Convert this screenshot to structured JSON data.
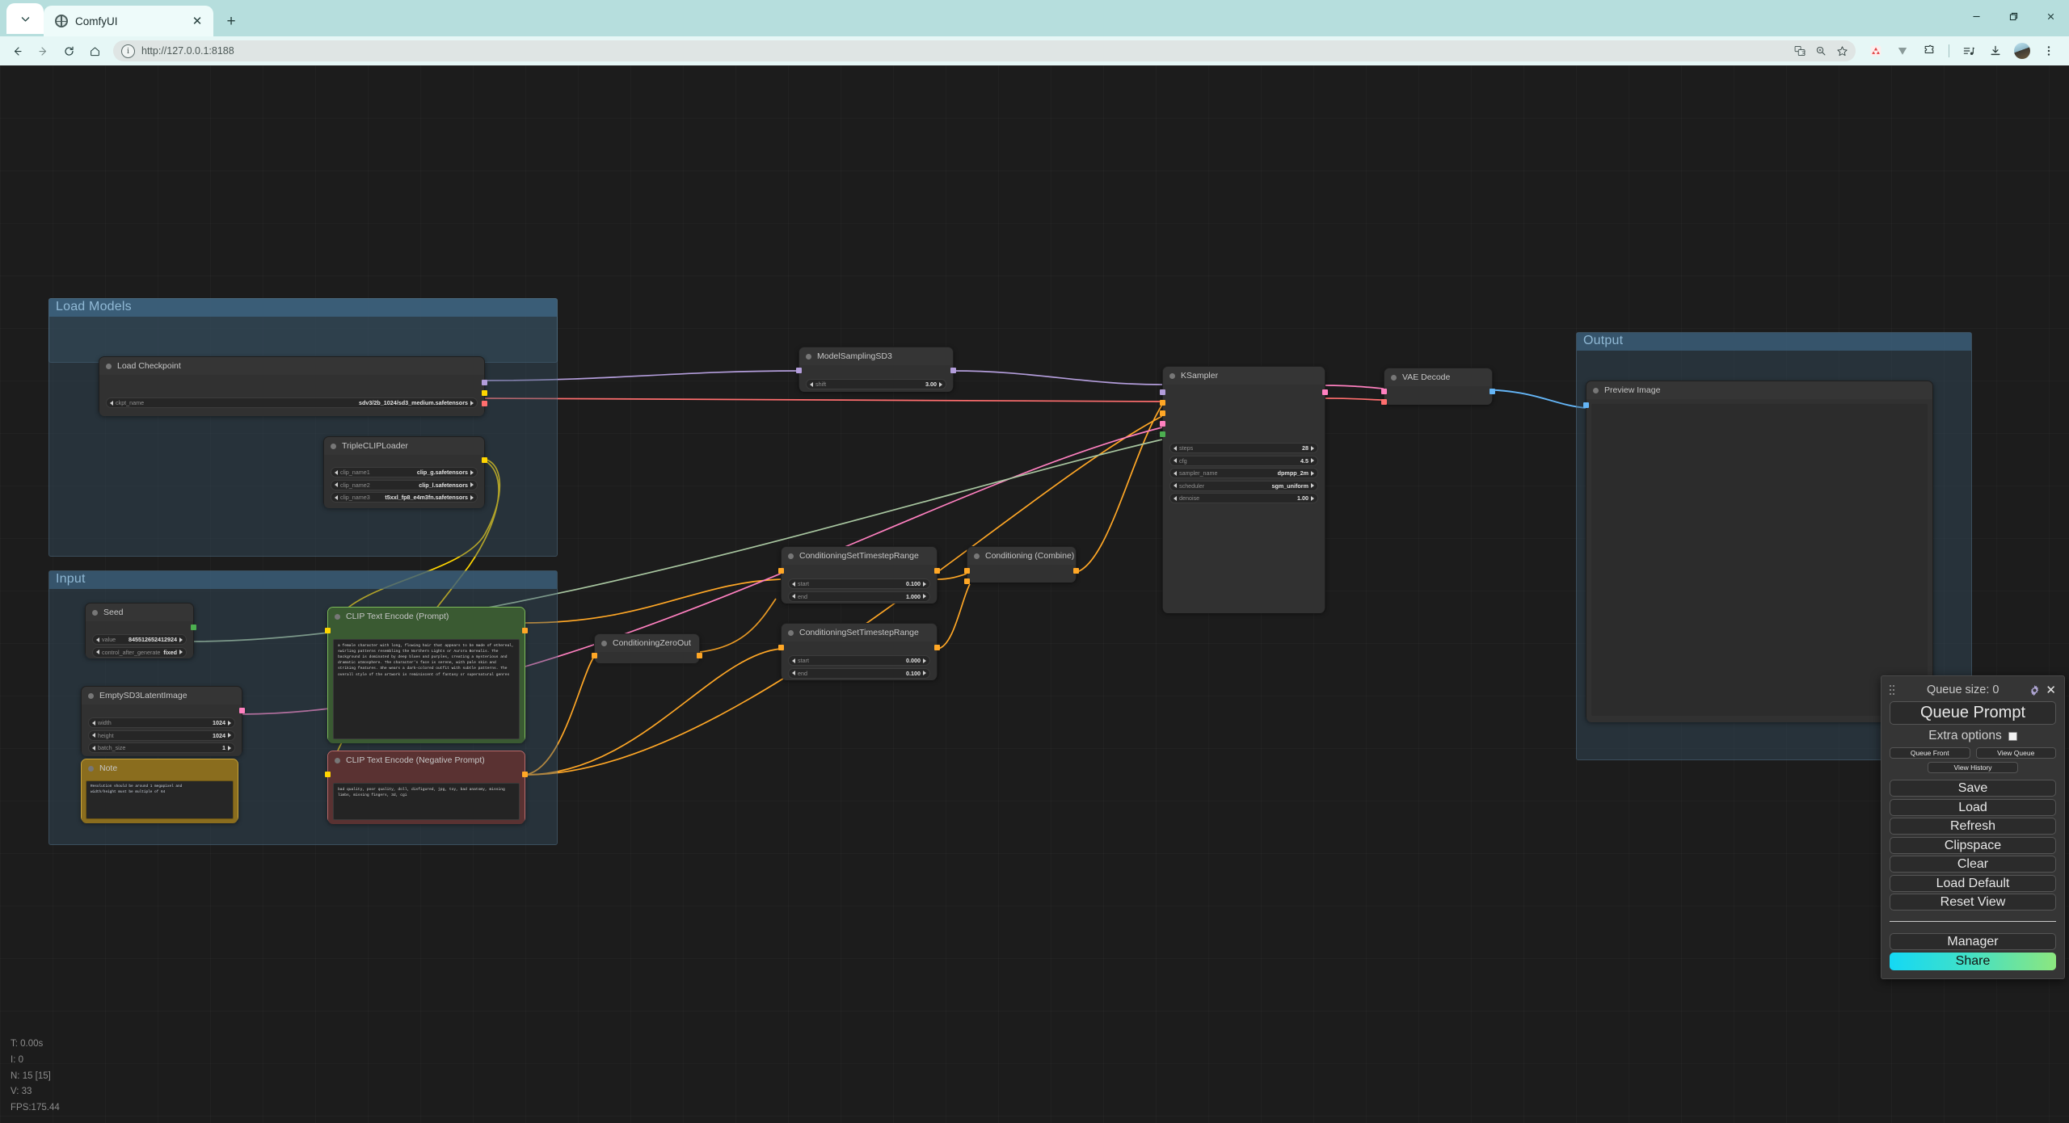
{
  "browser": {
    "tab": {
      "title": "ComfyUI",
      "favicon_icon": "globe-icon",
      "close_icon": "close-icon"
    },
    "new_tab_label": "+",
    "tab_list_icon": "chevron-down-icon",
    "nav": {
      "back_icon": "back-arrow-icon",
      "forward_icon": "forward-arrow-icon",
      "reload_icon": "reload-icon",
      "home_icon": "home-icon"
    },
    "omnibox": {
      "url": "http://127.0.0.1:8188",
      "info_icon": "page-info-icon",
      "translate_icon": "translate-icon",
      "zoom_icon": "zoom-icon",
      "bookmark_icon": "star-icon"
    },
    "extensions": [
      {
        "name": "extension-red-icon"
      },
      {
        "name": "extension-v-icon"
      },
      {
        "name": "extensions-puzzle-icon"
      },
      {
        "name": "media-list-icon"
      },
      {
        "name": "downloads-icon"
      },
      {
        "name": "profile-avatar-icon"
      },
      {
        "name": "chrome-menu-icon"
      }
    ],
    "window_controls": {
      "minimize": "minimize-icon",
      "maximize": "maximize-icon",
      "close": "window-close-icon"
    }
  },
  "groups": [
    {
      "title": "Load Models"
    },
    {
      "title": "Input"
    },
    {
      "title": "Output"
    }
  ],
  "nodes": {
    "load_checkpoint": {
      "title": "Load Checkpoint",
      "widgets": [
        {
          "name": "ckpt_name",
          "value": "sdv3/2b_1024/sd3_medium.safetensors"
        }
      ]
    },
    "triple_clip_loader": {
      "title": "TripleCLIPLoader",
      "widgets": [
        {
          "name": "clip_name1",
          "value": "clip_g.safetensors"
        },
        {
          "name": "clip_name2",
          "value": "clip_l.safetensors"
        },
        {
          "name": "clip_name3",
          "value": "t5xxl_fp8_e4m3fn.safetensors"
        }
      ]
    },
    "seed": {
      "title": "Seed",
      "widgets": [
        {
          "name": "value",
          "value": "845512652412924"
        },
        {
          "name": "control_after_generate",
          "value": "fixed"
        }
      ]
    },
    "empty_sd3_latent": {
      "title": "EmptySD3LatentImage",
      "widgets": [
        {
          "name": "width",
          "value": "1024"
        },
        {
          "name": "height",
          "value": "1024"
        },
        {
          "name": "batch_size",
          "value": "1"
        }
      ]
    },
    "note": {
      "title": "Note",
      "text": "Resolution should be around 1 megapixel and\nwidth/height must be multiple of 64"
    },
    "clip_text_encode_positive": {
      "title": "CLIP Text Encode (Prompt)",
      "text": "a female character with long, flowing hair that appears to be made of ethereal, swirling patterns resembling the Northern Lights or Aurora Borealis. The background is dominated by deep blues and purples, creating a mysterious and dramatic atmosphere. The character's face is serene, with pale skin and striking features. She wears a dark-colored outfit with subtle patterns. The overall style of the artwork is reminiscent of fantasy or supernatural genres"
    },
    "clip_text_encode_negative": {
      "title": "CLIP Text Encode (Negative Prompt)",
      "text": "bad quality, poor quality, doll, disfigured, jpg, toy, bad anatomy, missing limbs, missing fingers, 3d, cgi"
    },
    "model_sampling_sd3": {
      "title": "ModelSamplingSD3",
      "widgets": [
        {
          "name": "shift",
          "value": "3.00"
        }
      ]
    },
    "cond_set_range_1": {
      "title": "ConditioningSetTimestepRange",
      "widgets": [
        {
          "name": "start",
          "value": "0.100"
        },
        {
          "name": "end",
          "value": "1.000"
        }
      ]
    },
    "cond_set_range_2": {
      "title": "ConditioningSetTimestepRange",
      "widgets": [
        {
          "name": "start",
          "value": "0.000"
        },
        {
          "name": "end",
          "value": "0.100"
        }
      ]
    },
    "conditioning_combine": {
      "title": "Conditioning (Combine)",
      "widgets": []
    },
    "conditioning_zero_out": {
      "title": "ConditioningZeroOut",
      "widgets": []
    },
    "ksampler": {
      "title": "KSampler",
      "widgets": [
        {
          "name": "steps",
          "value": "28"
        },
        {
          "name": "cfg",
          "value": "4.5"
        },
        {
          "name": "sampler_name",
          "value": "dpmpp_2m"
        },
        {
          "name": "scheduler",
          "value": "sgm_uniform"
        },
        {
          "name": "denoise",
          "value": "1.00"
        }
      ]
    },
    "vae_decode": {
      "title": "VAE Decode",
      "widgets": []
    },
    "preview_image": {
      "title": "Preview Image",
      "widgets": []
    }
  },
  "menu": {
    "queue_size_label": "Queue size: 0",
    "gear_icon": "gear-icon",
    "close_icon": "close-icon",
    "drag_icon": "drag-handle-icon",
    "queue_prompt": "Queue Prompt",
    "extra_options": "Extra options",
    "queue_front": "Queue Front",
    "view_queue": "View Queue",
    "view_history": "View History",
    "save": "Save",
    "load": "Load",
    "refresh": "Refresh",
    "clipspace": "Clipspace",
    "clear": "Clear",
    "load_default": "Load Default",
    "reset_view": "Reset View",
    "manager": "Manager",
    "share": "Share"
  },
  "stats": {
    "time": "T: 0.00s",
    "iterations": "I: 0",
    "nodes": "N: 15 [15]",
    "vertices": "V: 33",
    "fps": "FPS:175.44"
  },
  "colors": {
    "accent": "#8fb8d4",
    "group_bg": "#3a5468",
    "node_bg": "#353535",
    "positive_prompt": "#3a5a32",
    "negative_prompt": "#5a3232",
    "note": "#8a6d1e",
    "link_model": "#b39ddb",
    "link_clip": "#ffd500",
    "link_vae": "#ff6e6e",
    "link_cond": "#ffa726",
    "link_latent": "#ff80c0",
    "link_image": "#64b5f6",
    "link_int": "#a8c6a0"
  }
}
